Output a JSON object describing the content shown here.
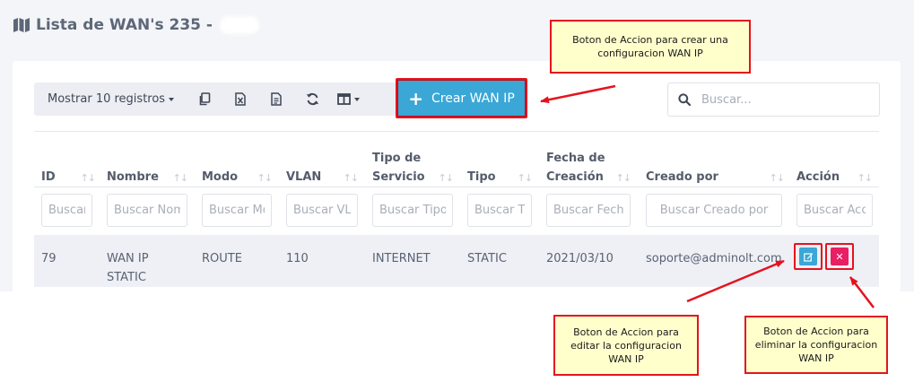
{
  "page": {
    "title": "Lista de WAN's 235 -",
    "title_icon": "map-icon"
  },
  "toolbar": {
    "show_label": "Mostrar 10 registros",
    "copy_icon": "copy-icon",
    "excel_icon": "excel-icon",
    "csv_icon": "csv-icon",
    "refresh_icon": "refresh-icon",
    "columns_icon": "columns-icon",
    "create_label": "Crear WAN IP"
  },
  "search": {
    "placeholder": "Buscar..."
  },
  "table": {
    "headers": [
      {
        "line1": "",
        "line2": "ID"
      },
      {
        "line1": "",
        "line2": "Nombre"
      },
      {
        "line1": "",
        "line2": "Modo"
      },
      {
        "line1": "",
        "line2": "VLAN"
      },
      {
        "line1": "Tipo de",
        "line2": "Servicio"
      },
      {
        "line1": "",
        "line2": "Tipo"
      },
      {
        "line1": "Fecha de",
        "line2": "Creación"
      },
      {
        "line1": "",
        "line2": "Creado por"
      },
      {
        "line1": "",
        "line2": "Acción"
      }
    ],
    "filters": [
      "Buscar ID",
      "Buscar Nombre",
      "Buscar Modo",
      "Buscar VLAN",
      "Buscar Tipo de Servicio",
      "Buscar Tipo",
      "Buscar Fecha de Creación",
      "Buscar Creado por",
      "Buscar Acción"
    ],
    "rows": [
      {
        "id": "79",
        "nombre_l1": "WAN IP",
        "nombre_l2": "STATIC",
        "modo": "ROUTE",
        "vlan": "110",
        "tipo_servicio": "INTERNET",
        "tipo": "STATIC",
        "fecha": "2021/03/10",
        "creado_por": "soporte@adminolt.com"
      }
    ]
  },
  "annotations": {
    "create": "Boton de Accion para crear una configuracion WAN IP",
    "edit": "Boton de Accion para editar la configuracion WAN IP",
    "delete": "Boton de Accion para eliminar la configuracion WAN IP"
  },
  "colors": {
    "primary": "#3aa7d6",
    "danger": "#e91e63",
    "annotation_border": "#e5131e",
    "annotation_fill": "#ffffcc"
  }
}
